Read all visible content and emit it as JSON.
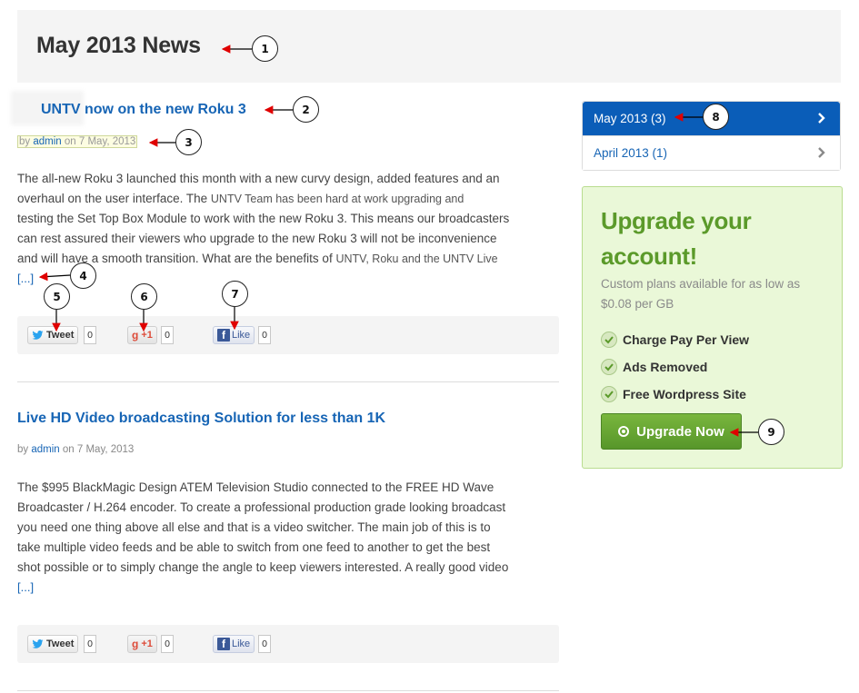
{
  "page": {
    "title": "May 2013 News"
  },
  "posts": [
    {
      "title": "UNTV now on the new Roku 3",
      "meta_by": "by",
      "meta_author": "admin",
      "meta_on": "on 7 May, 2013",
      "excerpt_lines": [
        "The all-new Roku 3 launched this month with a new curvy design, added features and an",
        "overhaul on the user interface. The",
        "UNTV Team has been hard at work upgrading and",
        "testing the Set Top Box Module to work with the new Roku 3. This means our broadcasters",
        "can rest assured their viewers who upgrade to the new Roku 3 will not be inconvenience",
        "and will have a smooth transition. What are the benefits of",
        "UNTV, Roku and the UNTV Live"
      ],
      "read_more": "[...]",
      "share": {
        "tweet": "Tweet",
        "tweet_count": "0",
        "gplus": "+1",
        "gplus_count": "0",
        "like": "Like",
        "like_count": "0"
      }
    },
    {
      "title": "Live HD Video broadcasting Solution for less than 1K",
      "meta_by": "by",
      "meta_author": "admin",
      "meta_on": "on 7 May, 2013",
      "excerpt_lines": [
        "The $995 BlackMagic Design ATEM Television Studio connected to the FREE HD Wave",
        "Broadcaster / H.264 encoder. To create a professional production grade looking broadcast",
        "you need one thing above all else and that is a video switcher. The main job of this is to",
        "take multiple video feeds and be able to switch from one feed to another to get the best",
        "shot possible or to simply change the angle to keep viewers interested. A really good video"
      ],
      "read_more": "[...]",
      "share": {
        "tweet": "Tweet",
        "tweet_count": "0",
        "gplus": "+1",
        "gplus_count": "0",
        "like": "Like",
        "like_count": "0"
      }
    }
  ],
  "archive": [
    {
      "label": "May 2013 (3)",
      "active": true
    },
    {
      "label": "April 2013 (1)",
      "active": false
    }
  ],
  "upgrade": {
    "title": "Upgrade your account!",
    "subtitle": "Custom plans available for as low as $0.08 per GB",
    "features": [
      "Charge Pay Per View",
      "Ads Removed",
      "Free Wordpress Site"
    ],
    "button": "Upgrade Now"
  },
  "callouts": [
    "1",
    "2",
    "3",
    "4",
    "5",
    "6",
    "7",
    "8",
    "9"
  ],
  "colors": {
    "link": "#1765b5",
    "active_bg": "#0a5db8",
    "upgrade_bg": "#eaf8d8",
    "upgrade_title": "#5b9a2a",
    "button_green": "#6aa833",
    "arrow_red": "#e00000"
  }
}
